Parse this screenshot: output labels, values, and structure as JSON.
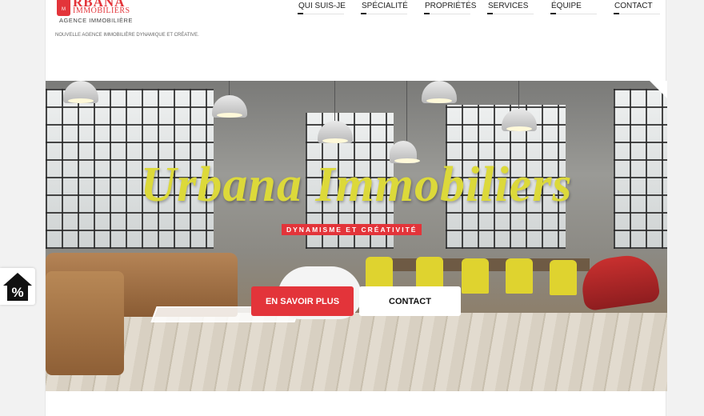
{
  "logo": {
    "badge_text": "M",
    "brand_line1": "RBANA",
    "brand_line2": "IMMOBILIERS",
    "subtitle": "AGENCE IMMOBILIÈRE"
  },
  "tagline": "NOUVELLE AGENCE IMMOBILIÈRE DYNAMIQUE ET CRÉATIVE.",
  "nav": {
    "items": [
      {
        "label": "QUI SUIS-JE"
      },
      {
        "label": "SPÉCIALITÉ"
      },
      {
        "label": "PROPRIÉTÉS"
      },
      {
        "label": "SERVICES"
      },
      {
        "label": "ÉQUIPE"
      },
      {
        "label": "CONTACT"
      }
    ]
  },
  "hero": {
    "title": "Urbana Immobiliers",
    "subtitle": "DYNAMISME ET CRÉATIVITÉ",
    "primary_button": "EN SAVOIR PLUS",
    "secondary_button": "CONTACT"
  },
  "promo": {
    "icon": "house-percent-icon",
    "symbol": "%"
  },
  "colors": {
    "accent_red": "#e3343a",
    "title_yellow": "#dcd93a"
  }
}
